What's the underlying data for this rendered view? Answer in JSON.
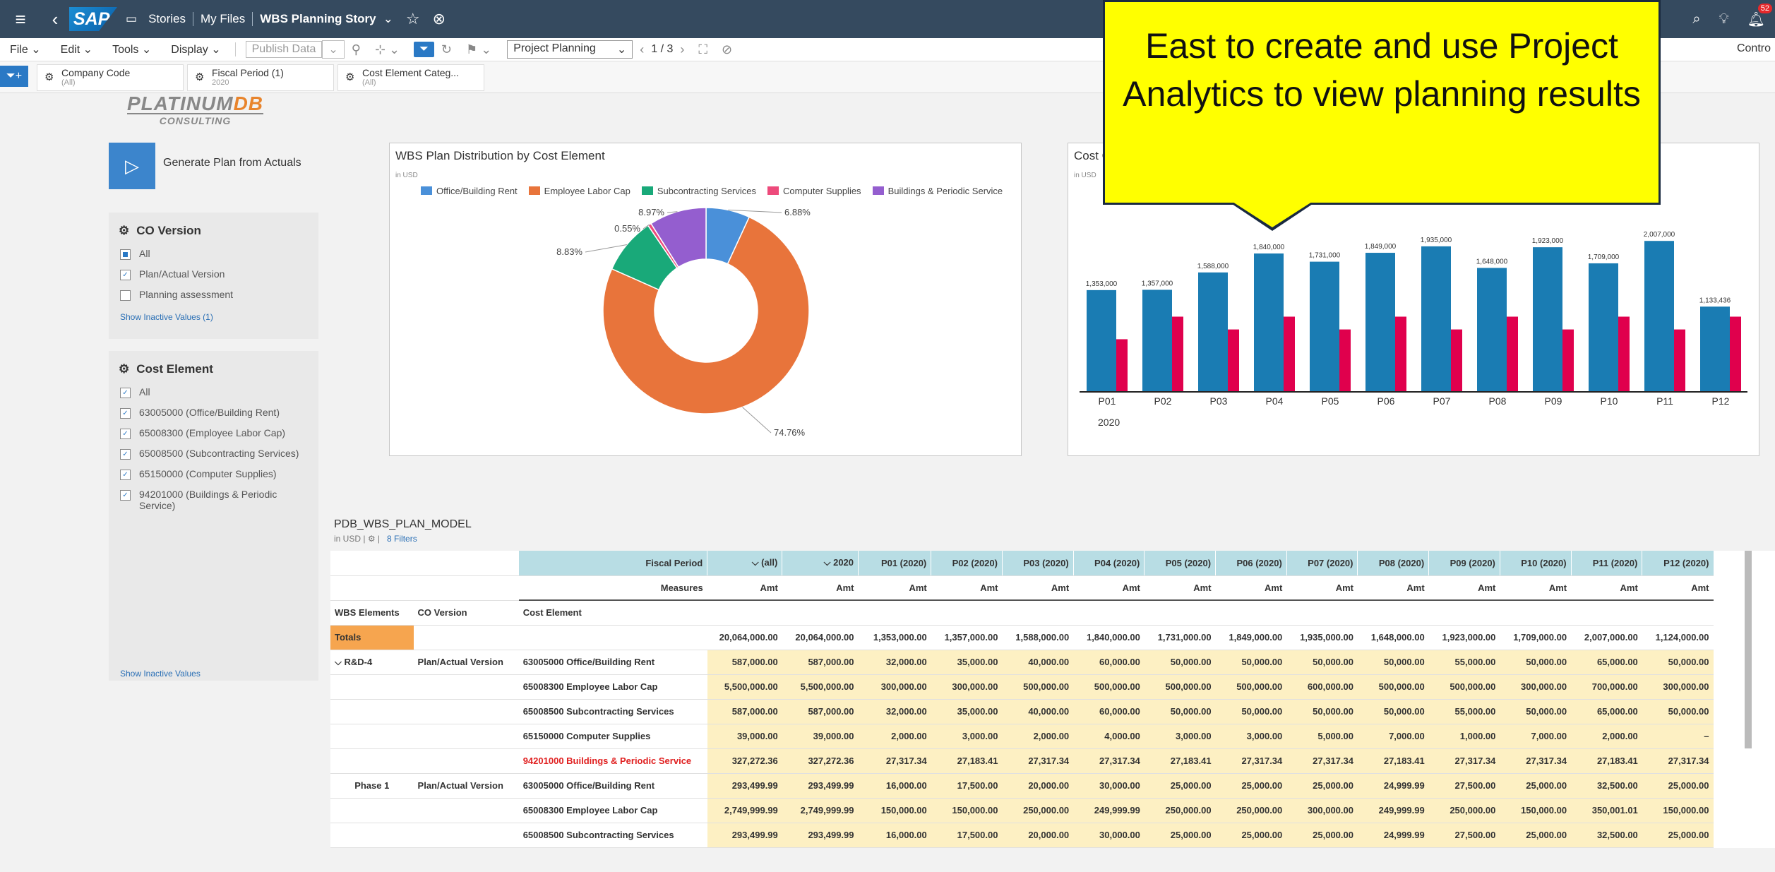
{
  "shell": {
    "breadcrumbs": [
      "Stories",
      "My Files"
    ],
    "story_title": "WBS Planning Story",
    "notification_count": "52"
  },
  "toolbar": {
    "file": "File",
    "edit": "Edit",
    "tools": "Tools",
    "display": "Display",
    "publish": "Publish Data",
    "selected_version": "Project Planning",
    "page_indicator": "1 / 3",
    "right_label": "Contro"
  },
  "filterbar": {
    "tokens": [
      {
        "label": "Company Code",
        "value": "(All)"
      },
      {
        "label": "Fiscal Period (1)",
        "value": "2020"
      },
      {
        "label": "Cost Element Categ...",
        "value": "(All)"
      }
    ]
  },
  "logo": {
    "line1a": "PLATINUM",
    "line1b": "DB",
    "line2": "CONSULTING"
  },
  "generate_label": "Generate Plan from Actuals",
  "co_version": {
    "title": "CO Version",
    "items": [
      "All",
      "Plan/Actual Version",
      "Planning assessment"
    ],
    "link": "Show Inactive Values (1)"
  },
  "cost_element_filter": {
    "title": "Cost Element",
    "items": [
      "All",
      "63005000 (Office/Building Rent)",
      "65008300 (Employee Labor Cap)",
      "65008500 (Subcontracting Services)",
      "65150000 (Computer Supplies)",
      "94201000 (Buildings & Periodic Service)"
    ],
    "link": "Show Inactive Values"
  },
  "callout": {
    "text": "East to create and use Project Analytics to view planning results"
  },
  "donut": {
    "title": "WBS Plan Distribution by Cost Element",
    "subtitle": "in USD",
    "colors": [
      "#4a90d9",
      "#e8743b",
      "#19a979",
      "#ed4a7b",
      "#945ecf"
    ]
  },
  "bar_card": {
    "title": "Cost C",
    "subtitle": "in USD"
  },
  "chart_data": [
    {
      "type": "pie",
      "title": "WBS Plan Distribution by Cost Element",
      "subtitle": "in USD",
      "categories": [
        "Office/Building Rent",
        "Employee Labor Cap",
        "Subcontracting Services",
        "Computer Supplies",
        "Buildings & Periodic Service"
      ],
      "values": [
        6.88,
        74.76,
        8.83,
        0.55,
        8.97
      ],
      "labels": [
        "6.88%",
        "74.76%",
        "8.83%",
        "0.55%",
        "8.97%"
      ],
      "legend": "top"
    },
    {
      "type": "bar",
      "title": "Cost C",
      "subtitle": "in USD",
      "categories": [
        "P01",
        "P02",
        "P03",
        "P04",
        "P05",
        "P06",
        "P07",
        "P08",
        "P09",
        "P10",
        "P11",
        "P12"
      ],
      "group_label": "2020",
      "series": [
        {
          "values": [
            1353000,
            1357000,
            1588000,
            1840000,
            1731000,
            1849000,
            1935000,
            1648000,
            1923000,
            1709000,
            2007000,
            1133436
          ],
          "labels": [
            "1,353,000",
            "1,357,000",
            "1,588,000",
            "1,840,000",
            "1,731,000",
            "1,849,000",
            "1,935,000",
            "1,648,000",
            "1,923,000",
            "1,709,000",
            "2,007,000",
            "1,133,436"
          ],
          "color": "#1a7cb3"
        },
        {
          "values": [
            700000,
            1000000,
            830000,
            1000000,
            830000,
            1000000,
            830000,
            1000000,
            830000,
            1000000,
            830000,
            1000000
          ],
          "color": "#e0004d"
        }
      ],
      "ylim": [
        0,
        2300000
      ]
    }
  ],
  "model": {
    "title": "PDB_WBS_PLAN_MODEL",
    "unit": "in USD",
    "filters": "8 Filters"
  },
  "table": {
    "fiscal_period_label": "Fiscal Period",
    "measures_label": "Measures",
    "columns": [
      "(all)",
      "2020",
      "P01 (2020)",
      "P02 (2020)",
      "P03 (2020)",
      "P04 (2020)",
      "P05 (2020)",
      "P06 (2020)",
      "P07 (2020)",
      "P08 (2020)",
      "P09 (2020)",
      "P10 (2020)",
      "P11 (2020)",
      "P12 (2020)"
    ],
    "measure": "Amt",
    "dim_headers": [
      "WBS Elements",
      "CO Version",
      "Cost Element"
    ],
    "totals_label": "Totals",
    "totals": [
      "20,064,000.00",
      "20,064,000.00",
      "1,353,000.00",
      "1,357,000.00",
      "1,588,000.00",
      "1,840,000.00",
      "1,731,000.00",
      "1,849,000.00",
      "1,935,000.00",
      "1,648,000.00",
      "1,923,000.00",
      "1,709,000.00",
      "2,007,000.00",
      "1,124,000.00"
    ],
    "rows": [
      {
        "wbs": "R&D-4",
        "ver": "Plan/Actual Version",
        "ce": "63005000 Office/Building Rent",
        "red": false,
        "v": [
          "587,000.00",
          "587,000.00",
          "32,000.00",
          "35,000.00",
          "40,000.00",
          "60,000.00",
          "50,000.00",
          "50,000.00",
          "50,000.00",
          "50,000.00",
          "55,000.00",
          "50,000.00",
          "65,000.00",
          "50,000.00"
        ]
      },
      {
        "wbs": "",
        "ver": "",
        "ce": "65008300 Employee Labor Cap",
        "red": false,
        "v": [
          "5,500,000.00",
          "5,500,000.00",
          "300,000.00",
          "300,000.00",
          "500,000.00",
          "500,000.00",
          "500,000.00",
          "500,000.00",
          "600,000.00",
          "500,000.00",
          "500,000.00",
          "300,000.00",
          "700,000.00",
          "300,000.00"
        ]
      },
      {
        "wbs": "",
        "ver": "",
        "ce": "65008500 Subcontracting Services",
        "red": false,
        "v": [
          "587,000.00",
          "587,000.00",
          "32,000.00",
          "35,000.00",
          "40,000.00",
          "60,000.00",
          "50,000.00",
          "50,000.00",
          "50,000.00",
          "50,000.00",
          "55,000.00",
          "50,000.00",
          "65,000.00",
          "50,000.00"
        ]
      },
      {
        "wbs": "",
        "ver": "",
        "ce": "65150000 Computer Supplies",
        "red": false,
        "v": [
          "39,000.00",
          "39,000.00",
          "2,000.00",
          "3,000.00",
          "2,000.00",
          "4,000.00",
          "3,000.00",
          "3,000.00",
          "5,000.00",
          "7,000.00",
          "1,000.00",
          "7,000.00",
          "2,000.00",
          "–"
        ]
      },
      {
        "wbs": "",
        "ver": "",
        "ce": "94201000 Buildings & Periodic Service",
        "red": true,
        "v": [
          "327,272.36",
          "327,272.36",
          "27,317.34",
          "27,183.41",
          "27,317.34",
          "27,317.34",
          "27,183.41",
          "27,317.34",
          "27,317.34",
          "27,183.41",
          "27,317.34",
          "27,317.34",
          "27,183.41",
          "27,317.34"
        ]
      },
      {
        "wbs": "Phase 1",
        "ver": "Plan/Actual Version",
        "ce": "63005000 Office/Building Rent",
        "red": false,
        "v": [
          "293,499.99",
          "293,499.99",
          "16,000.00",
          "17,500.00",
          "20,000.00",
          "30,000.00",
          "25,000.00",
          "25,000.00",
          "25,000.00",
          "24,999.99",
          "27,500.00",
          "25,000.00",
          "32,500.00",
          "25,000.00"
        ]
      },
      {
        "wbs": "",
        "ver": "",
        "ce": "65008300 Employee Labor Cap",
        "red": false,
        "v": [
          "2,749,999.99",
          "2,749,999.99",
          "150,000.00",
          "150,000.00",
          "250,000.00",
          "249,999.99",
          "250,000.00",
          "250,000.00",
          "300,000.00",
          "249,999.99",
          "250,000.00",
          "150,000.00",
          "350,001.01",
          "150,000.00"
        ]
      },
      {
        "wbs": "",
        "ver": "",
        "ce": "65008500 Subcontracting Services",
        "red": false,
        "v": [
          "293,499.99",
          "293,499.99",
          "16,000.00",
          "17,500.00",
          "20,000.00",
          "30,000.00",
          "25,000.00",
          "25,000.00",
          "25,000.00",
          "24,999.99",
          "27,500.00",
          "25,000.00",
          "32,500.00",
          "25,000.00"
        ]
      }
    ]
  }
}
